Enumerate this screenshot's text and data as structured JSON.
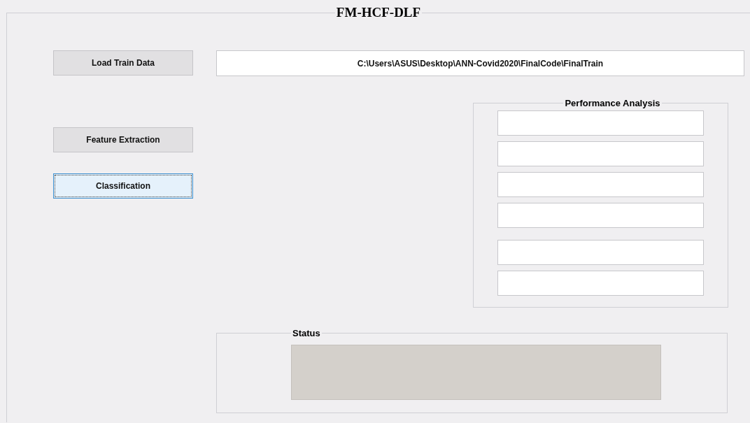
{
  "window": {
    "title": "FM-HCF-DLF"
  },
  "buttons": [
    {
      "label": "Load Train Data",
      "selected": false
    },
    {
      "label": "Feature Extraction",
      "selected": false
    },
    {
      "label": "Classification",
      "selected": true
    }
  ],
  "path_field": {
    "value": "C:\\Users\\ASUS\\Desktop\\ANN-Covid2020\\FinalCode\\FinalTrain"
  },
  "performance_analysis": {
    "title": "Performance Analysis",
    "fields": [
      {
        "kind": "field"
      },
      {
        "kind": "field"
      },
      {
        "kind": "field"
      },
      {
        "kind": "field"
      },
      {
        "kind": "gap"
      },
      {
        "kind": "field"
      },
      {
        "kind": "field"
      }
    ]
  },
  "status": {
    "title": "Status"
  }
}
